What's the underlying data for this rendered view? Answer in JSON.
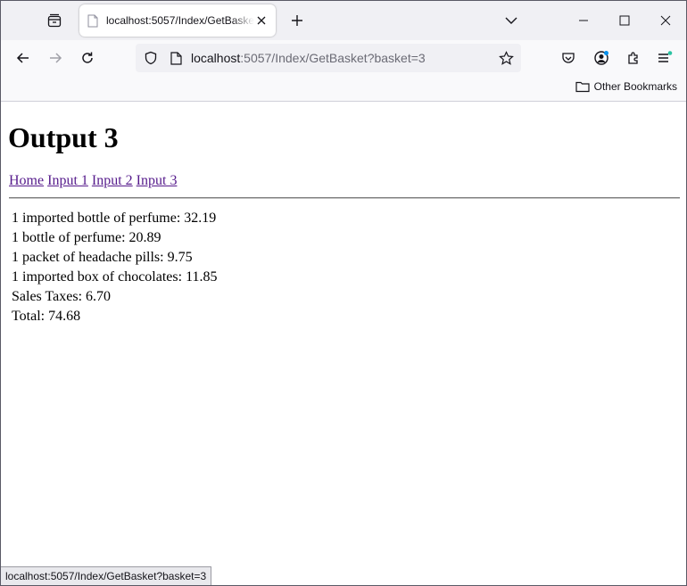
{
  "browser": {
    "tab": {
      "title": "localhost:5057/Index/GetBasket"
    },
    "address": {
      "host": "localhost",
      "rest": ":5057/Index/GetBasket?basket=3"
    },
    "bookmarks": {
      "other_label": "Other Bookmarks"
    },
    "status_url": "localhost:5057/Index/GetBasket?basket=3"
  },
  "page": {
    "heading": "Output 3",
    "nav_links": [
      "Home",
      "Input 1",
      "Input 2",
      "Input 3"
    ],
    "items": [
      "1 imported bottle of perfume: 32.19",
      "1 bottle of perfume: 20.89",
      "1 packet of headache pills: 9.75",
      "1 imported box of chocolates: 11.85"
    ],
    "sales_taxes": "Sales Taxes: 6.70",
    "total": "Total: 74.68"
  },
  "colors": {
    "visited_link": "#551a8b",
    "accent_badge": "#2ac3a2"
  }
}
